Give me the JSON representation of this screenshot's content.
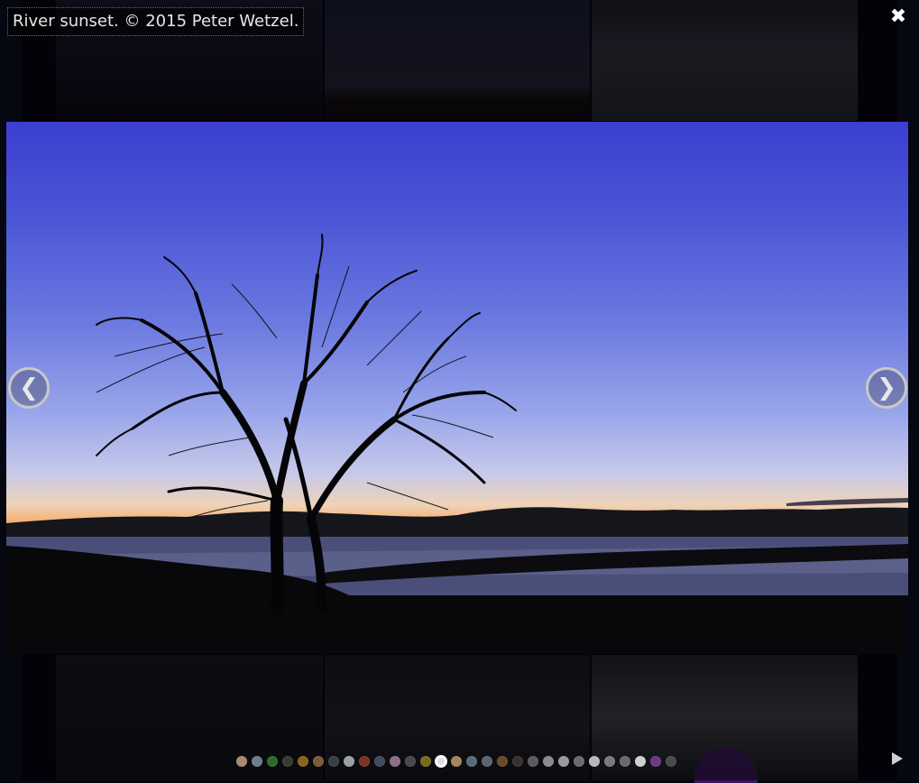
{
  "caption": "River sunset. © 2015 Peter Wetzel.",
  "controls": {
    "close_glyph": "✖",
    "prev_glyph": "❮",
    "next_glyph": "❯",
    "play_icon": "play-icon"
  },
  "slideshow": {
    "total": 29,
    "current_index": 13,
    "dot_colors": [
      "#a8896b",
      "#6f7d88",
      "#2e6b2a",
      "#3a3b2c",
      "#8a6418",
      "#7a5c35",
      "#3b3f45",
      "#9aa0a8",
      "#7a3325",
      "#3f4a5a",
      "#8a6f88",
      "#4a4a4a",
      "#7a6a1c",
      "#d8dcef",
      "#a0865a",
      "#5a6a7a",
      "#5a6470",
      "#6b4a2a",
      "#3a3030",
      "#5a5a5a",
      "#8a8a8a",
      "#9a9a9a",
      "#6a6a6a",
      "#b8b8b8",
      "#7a7a7a",
      "#6a6a70",
      "#cfcfcf",
      "#6a3a8a",
      "#4a4a4a",
      "#b0521c"
    ]
  },
  "colors": {
    "sky_top": "#3c3fd0",
    "horizon": "#e06a1e",
    "background": "#05060d"
  }
}
